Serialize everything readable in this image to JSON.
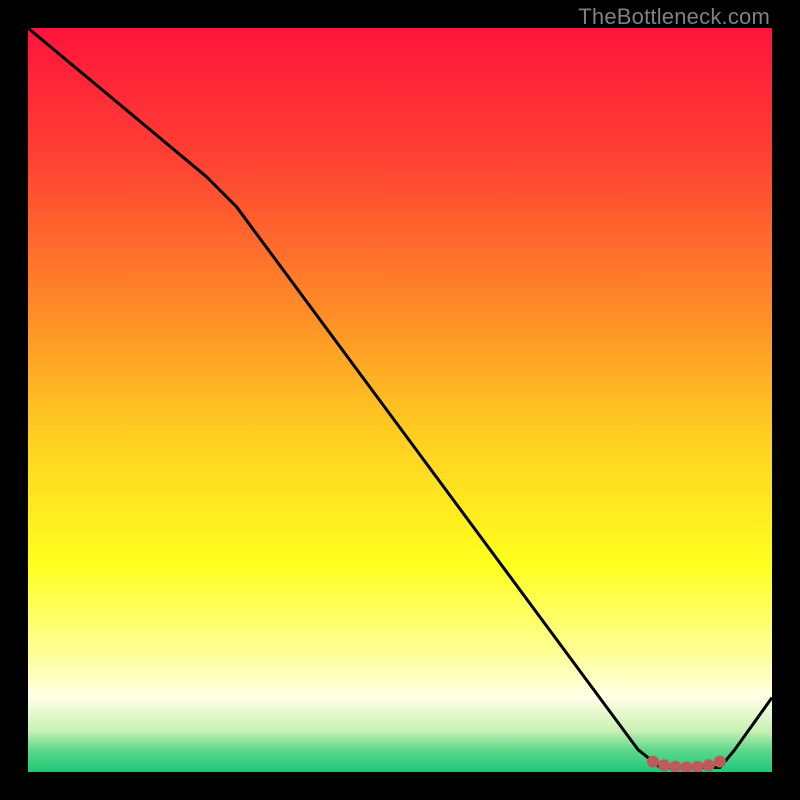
{
  "watermark": "TheBottleneck.com",
  "chart_data": {
    "type": "line",
    "title": "",
    "xlabel": "",
    "ylabel": "",
    "xlim": [
      0,
      100
    ],
    "ylim": [
      0,
      100
    ],
    "gradient_stops": [
      {
        "pos": 0.0,
        "color": "#ff143c"
      },
      {
        "pos": 0.18,
        "color": "#ff4232"
      },
      {
        "pos": 0.38,
        "color": "#ff8c28"
      },
      {
        "pos": 0.55,
        "color": "#ffcf20"
      },
      {
        "pos": 0.72,
        "color": "#ffff1e"
      },
      {
        "pos": 0.84,
        "color": "#ffff96"
      },
      {
        "pos": 0.9,
        "color": "#ffffe6"
      },
      {
        "pos": 0.945,
        "color": "#c8f0b4"
      },
      {
        "pos": 0.97,
        "color": "#5fd88c"
      },
      {
        "pos": 1.0,
        "color": "#1ec878"
      }
    ],
    "series": [
      {
        "name": "curve",
        "type": "line",
        "points": [
          {
            "x": 0.0,
            "y": 100.0
          },
          {
            "x": 24.0,
            "y": 80.0
          },
          {
            "x": 28.0,
            "y": 76.0
          },
          {
            "x": 82.0,
            "y": 3.0
          },
          {
            "x": 85.0,
            "y": 0.6
          },
          {
            "x": 93.0,
            "y": 0.6
          },
          {
            "x": 95.0,
            "y": 3.0
          },
          {
            "x": 100.0,
            "y": 10.0
          }
        ]
      },
      {
        "name": "minimum-markers",
        "type": "scatter",
        "color": "#bd5a5a",
        "points": [
          {
            "x": 84.0,
            "y": 1.4
          },
          {
            "x": 85.5,
            "y": 0.9
          },
          {
            "x": 87.0,
            "y": 0.7
          },
          {
            "x": 88.5,
            "y": 0.6
          },
          {
            "x": 90.0,
            "y": 0.7
          },
          {
            "x": 91.5,
            "y": 0.9
          },
          {
            "x": 93.0,
            "y": 1.4
          }
        ]
      }
    ]
  }
}
